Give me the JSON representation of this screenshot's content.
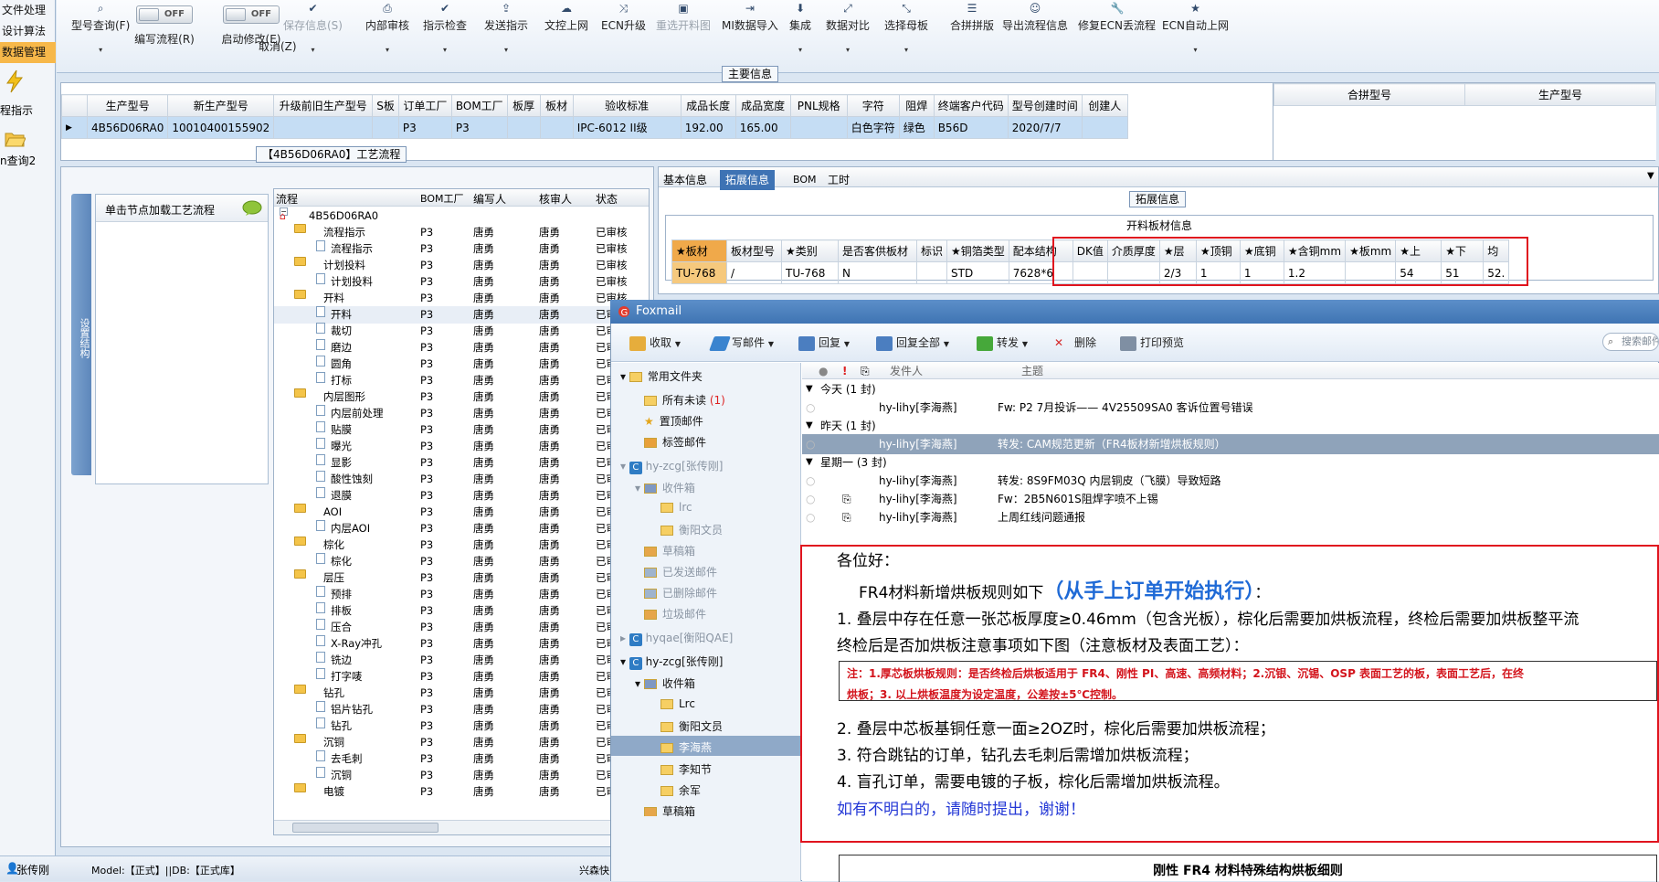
{
  "leftnav": {
    "items": [
      "文件处理",
      "设计算法",
      "数据管理"
    ],
    "links": [
      "程指示",
      "n查询2"
    ],
    "user": "张传刚"
  },
  "toolbar": {
    "buttons": [
      {
        "label": "型号查询(F)",
        "icon": "search-icon",
        "enabled": true
      },
      {
        "label": "编写流程(R)",
        "icon": "toggle-icon",
        "enabled": true
      },
      {
        "label": "启动修改(E)",
        "icon": "toggle-icon",
        "enabled": true
      },
      {
        "label": "保存信息(S)",
        "icon": "check-icon",
        "enabled": false
      },
      {
        "label": "内部审核",
        "icon": "printer-icon",
        "enabled": true
      },
      {
        "label": "指示检查",
        "icon": "check-icon",
        "enabled": true
      },
      {
        "label": "发送指示",
        "icon": "upload-icon",
        "enabled": true
      },
      {
        "label": "文控上网",
        "icon": "cloud-icon",
        "enabled": true
      },
      {
        "label": "ECN升级",
        "icon": "shuffle-icon",
        "enabled": true
      },
      {
        "label": "重选开料图",
        "icon": "image-icon",
        "enabled": false
      },
      {
        "label": "MI数据导入",
        "icon": "import-icon",
        "enabled": true
      },
      {
        "label": "集成",
        "icon": "download-icon",
        "enabled": true
      },
      {
        "label": "数据对比",
        "icon": "compare-icon",
        "enabled": true
      },
      {
        "label": "选择母板",
        "icon": "expand-icon",
        "enabled": true
      },
      {
        "label": "合拼拼版",
        "icon": "list-icon",
        "enabled": true
      },
      {
        "label": "导出流程信息",
        "icon": "smile-icon",
        "enabled": true
      },
      {
        "label": "修复ECN丢流程",
        "icon": "wrench-icon",
        "enabled": true
      },
      {
        "label": "ECN自动上网",
        "icon": "star-icon",
        "enabled": true
      }
    ],
    "toggle_off": "OFF",
    "cancel": "取消(Z)"
  },
  "main_info": {
    "title": "主要信息",
    "columns": [
      "生产型号",
      "新生产型号",
      "升级前旧生产型号",
      "S板",
      "订单工厂",
      "BOM工厂",
      "板厚",
      "板材",
      "验收标准",
      "成品长度",
      "成品宽度",
      "PNL规格",
      "字符",
      "阻焊",
      "终端客户代码",
      "型号创建时间",
      "创建人"
    ],
    "row": [
      "4B56D06RA0",
      "10010400155902",
      "",
      "",
      "P3",
      "P3",
      "",
      "",
      "IPC-6012 II级",
      "192.00",
      "165.00",
      "",
      "白色字符",
      "绿色",
      "B56D",
      "2020/7/7",
      ""
    ],
    "right_columns": [
      "合拼型号",
      "生产型号"
    ]
  },
  "process": {
    "title": "【4B56D06RA0】工艺流程",
    "vtab": "设置结构",
    "node_hint": "单击节点加载工艺流程",
    "columns": [
      "流程",
      "BOM工厂",
      "编写人",
      "核审人",
      "状态"
    ],
    "rows": [
      {
        "name": "4B56D06RA0",
        "level": 0,
        "type": "root",
        "bom": "",
        "writer": "",
        "reviewer": "",
        "status": ""
      },
      {
        "name": "流程指示",
        "level": 1,
        "type": "folder",
        "bom": "P3",
        "writer": "唐勇",
        "reviewer": "唐勇",
        "status": "已审核"
      },
      {
        "name": "流程指示",
        "level": 2,
        "type": "doc",
        "bom": "P3",
        "writer": "唐勇",
        "reviewer": "唐勇",
        "status": "已审核"
      },
      {
        "name": "计划投料",
        "level": 1,
        "type": "folder",
        "bom": "P3",
        "writer": "唐勇",
        "reviewer": "唐勇",
        "status": "已审核"
      },
      {
        "name": "计划投料",
        "level": 2,
        "type": "doc",
        "bom": "P3",
        "writer": "唐勇",
        "reviewer": "唐勇",
        "status": "已审核"
      },
      {
        "name": "开料",
        "level": 1,
        "type": "folder",
        "bom": "P3",
        "writer": "唐勇",
        "reviewer": "唐勇",
        "status": "已审核"
      },
      {
        "name": "开料",
        "level": 2,
        "type": "doc",
        "bom": "P3",
        "writer": "唐勇",
        "reviewer": "唐勇",
        "status": "已审核"
      },
      {
        "name": "裁切",
        "level": 2,
        "type": "doc",
        "bom": "P3",
        "writer": "唐勇",
        "reviewer": "唐勇",
        "status": "已审核"
      },
      {
        "name": "磨边",
        "level": 2,
        "type": "doc",
        "bom": "P3",
        "writer": "唐勇",
        "reviewer": "唐勇",
        "status": "已审核"
      },
      {
        "name": "圆角",
        "level": 2,
        "type": "doc",
        "bom": "P3",
        "writer": "唐勇",
        "reviewer": "唐勇",
        "status": "已审核"
      },
      {
        "name": "打标",
        "level": 2,
        "type": "doc",
        "bom": "P3",
        "writer": "唐勇",
        "reviewer": "唐勇",
        "status": "已审核"
      },
      {
        "name": "内层图形",
        "level": 1,
        "type": "folder",
        "bom": "P3",
        "writer": "唐勇",
        "reviewer": "唐勇",
        "status": "已审核"
      },
      {
        "name": "内层前处理",
        "level": 2,
        "type": "doc",
        "bom": "P3",
        "writer": "唐勇",
        "reviewer": "唐勇",
        "status": "已审核"
      },
      {
        "name": "贴膜",
        "level": 2,
        "type": "doc",
        "bom": "P3",
        "writer": "唐勇",
        "reviewer": "唐勇",
        "status": "已审核"
      },
      {
        "name": "曝光",
        "level": 2,
        "type": "doc",
        "bom": "P3",
        "writer": "唐勇",
        "reviewer": "唐勇",
        "status": "已审核"
      },
      {
        "name": "显影",
        "level": 2,
        "type": "doc",
        "bom": "P3",
        "writer": "唐勇",
        "reviewer": "唐勇",
        "status": "已审核"
      },
      {
        "name": "酸性蚀刻",
        "level": 2,
        "type": "doc",
        "bom": "P3",
        "writer": "唐勇",
        "reviewer": "唐勇",
        "status": "已审核"
      },
      {
        "name": "退膜",
        "level": 2,
        "type": "doc",
        "bom": "P3",
        "writer": "唐勇",
        "reviewer": "唐勇",
        "status": "已审核"
      },
      {
        "name": "AOI",
        "level": 1,
        "type": "folder",
        "bom": "P3",
        "writer": "唐勇",
        "reviewer": "唐勇",
        "status": "已审核"
      },
      {
        "name": "内层AOI",
        "level": 2,
        "type": "doc",
        "bom": "P3",
        "writer": "唐勇",
        "reviewer": "唐勇",
        "status": "已审核"
      },
      {
        "name": "棕化",
        "level": 1,
        "type": "folder",
        "bom": "P3",
        "writer": "唐勇",
        "reviewer": "唐勇",
        "status": "已审核"
      },
      {
        "name": "棕化",
        "level": 2,
        "type": "doc",
        "bom": "P3",
        "writer": "唐勇",
        "reviewer": "唐勇",
        "status": "已审核"
      },
      {
        "name": "层压",
        "level": 1,
        "type": "folder",
        "bom": "P3",
        "writer": "唐勇",
        "reviewer": "唐勇",
        "status": "已审核"
      },
      {
        "name": "预排",
        "level": 2,
        "type": "doc",
        "bom": "P3",
        "writer": "唐勇",
        "reviewer": "唐勇",
        "status": "已审核"
      },
      {
        "name": "排板",
        "level": 2,
        "type": "doc",
        "bom": "P3",
        "writer": "唐勇",
        "reviewer": "唐勇",
        "status": "已审核"
      },
      {
        "name": "压合",
        "level": 2,
        "type": "doc",
        "bom": "P3",
        "writer": "唐勇",
        "reviewer": "唐勇",
        "status": "已审核"
      },
      {
        "name": "X-Ray冲孔",
        "level": 2,
        "type": "doc",
        "bom": "P3",
        "writer": "唐勇",
        "reviewer": "唐勇",
        "status": "已审核"
      },
      {
        "name": "铣边",
        "level": 2,
        "type": "doc",
        "bom": "P3",
        "writer": "唐勇",
        "reviewer": "唐勇",
        "status": "已审核"
      },
      {
        "name": "打字唛",
        "level": 2,
        "type": "doc",
        "bom": "P3",
        "writer": "唐勇",
        "reviewer": "唐勇",
        "status": "已审核"
      },
      {
        "name": "钻孔",
        "level": 1,
        "type": "folder",
        "bom": "P3",
        "writer": "唐勇",
        "reviewer": "唐勇",
        "status": "已审核"
      },
      {
        "name": "铝片钻孔",
        "level": 2,
        "type": "doc",
        "bom": "P3",
        "writer": "唐勇",
        "reviewer": "唐勇",
        "status": "已审核"
      },
      {
        "name": "钻孔",
        "level": 2,
        "type": "doc",
        "bom": "P3",
        "writer": "唐勇",
        "reviewer": "唐勇",
        "status": "已审核"
      },
      {
        "name": "沉铜",
        "level": 1,
        "type": "folder",
        "bom": "P3",
        "writer": "唐勇",
        "reviewer": "唐勇",
        "status": "已审核"
      },
      {
        "name": "去毛刺",
        "level": 2,
        "type": "doc",
        "bom": "P3",
        "writer": "唐勇",
        "reviewer": "唐勇",
        "status": "已审核"
      },
      {
        "name": "沉铜",
        "level": 2,
        "type": "doc",
        "bom": "P3",
        "writer": "唐勇",
        "reviewer": "唐勇",
        "status": "已审核"
      },
      {
        "name": "电镀",
        "level": 1,
        "type": "folder",
        "bom": "P3",
        "writer": "唐勇",
        "reviewer": "唐勇",
        "status": "已审核"
      }
    ]
  },
  "right_panel": {
    "tabs": [
      "基本信息",
      "拓展信息",
      "BOM",
      "工时"
    ],
    "active_tab": 1,
    "title": "拓展信息",
    "table_title": "开料板材信息",
    "columns": [
      "★板材",
      "板材型号",
      "★类别",
      "是否客供板材",
      "标识",
      "★铜箔类型",
      "配本结构",
      "DK值",
      "介质厚度",
      "★层",
      "★顶铜",
      "★底铜",
      "★含铜mm",
      "★板mm",
      "★上",
      "★下",
      "均"
    ],
    "row": [
      "TU-768",
      "/",
      "TU-768",
      "N",
      "",
      "STD",
      "7628*6",
      "",
      "",
      "2/3",
      "1",
      "1",
      "1.2",
      "",
      "54",
      "51",
      "52."
    ]
  },
  "foxmail": {
    "title": "Foxmail",
    "toolbar": [
      "收取",
      "写邮件",
      "回复",
      "回复全部",
      "转发",
      "删除",
      "打印预览"
    ],
    "search_placeholder": "搜索邮件",
    "common_folder": "常用文件夹",
    "common_items": [
      {
        "label": "所有未读",
        "count": "(1)"
      },
      {
        "label": "置顶邮件",
        "count": ""
      },
      {
        "label": "标签邮件",
        "count": ""
      }
    ],
    "account1": "hy-zcg[张传刚]",
    "account1_items": [
      "收件箱",
      "lrc",
      "衡阳文员",
      "草稿箱",
      "已发送邮件",
      "已删除邮件",
      "垃圾邮件"
    ],
    "account2": "hyqae[衡阳QAE]",
    "account3": "hy-zcg[张传刚]",
    "account3_items": [
      "收件箱",
      "Lrc",
      "衡阳文员",
      "李海燕",
      "李知节",
      "余军",
      "草稿箱"
    ],
    "list_headers": [
      "发件人",
      "主题"
    ],
    "groups": [
      {
        "label": "今天 (1 封)",
        "mails": [
          {
            "from": "hy-lihy[李海燕]",
            "subject": "Fw: P2  7月投诉—— 4V25509SA0 客诉位置号错误",
            "attach": false
          }
        ]
      },
      {
        "label": "昨天 (1 封)",
        "mails": [
          {
            "from": "hy-lihy[李海燕]",
            "subject": "转发: CAM规范更新（FR4板材新增烘板规则）",
            "attach": false,
            "selected": true
          }
        ]
      },
      {
        "label": "星期一 (3 封)",
        "mails": [
          {
            "from": "hy-lihy[李海燕]",
            "subject": "转发: 8S9FM03Q 内层铜皮（飞膜）导致短路",
            "attach": false
          },
          {
            "from": "hy-lihy[李海燕]",
            "subject": "Fw：2B5N601S阻焊字喷不上锡",
            "attach": true
          },
          {
            "from": "hy-lihy[李海燕]",
            "subject": "上周红线问题通报",
            "attach": true
          }
        ]
      }
    ],
    "body": {
      "greeting": "各位好：",
      "line1_a": "FR4材料新增烘板规则如下",
      "line1_b": "（从手上订单开始执行）",
      "line1_c": "：",
      "item1": "1. 叠层中存在任意一张芯板厚度≥0.46mm（包含光板），棕化后需要加烘板流程，终检后需要加烘板整平流",
      "item1b": "终检后是否加烘板注意事项如下图（注意板材及表面工艺）：",
      "note1": "注：1.厚芯板烘板规则：是否终检后烘板适用于 FR4、刚性 PI、高速、高频材料；2.沉银、沉锡、OSP 表面工艺的板，表面工艺后，在终",
      "note2": "烘板；3. 以上烘板温度为设定温度，公差按±5℃控制。",
      "item2": "2. 叠层中芯板基铜任意一面≥2OZ时，棕化后需要加烘板流程；",
      "item3": "3. 符合跳钻的订单，钻孔去毛刺后需增加烘板流程；",
      "item4": "4. 盲孔订单，需要电镀的子板，棕化后需增加烘板流程。",
      "closing": "如有不明白的，请随时提出，谢谢！",
      "table_caption": "刚性 FR4 材料特殊结构烘板细则"
    }
  },
  "status": {
    "model_db": "Model:【正式】||DB:【正式库】",
    "right": "兴森快"
  },
  "colors": {
    "accent": "#3e73b4",
    "highlight": "#f7b84a",
    "alert": "#e0141e",
    "selected_row": "#c5ddf4"
  }
}
